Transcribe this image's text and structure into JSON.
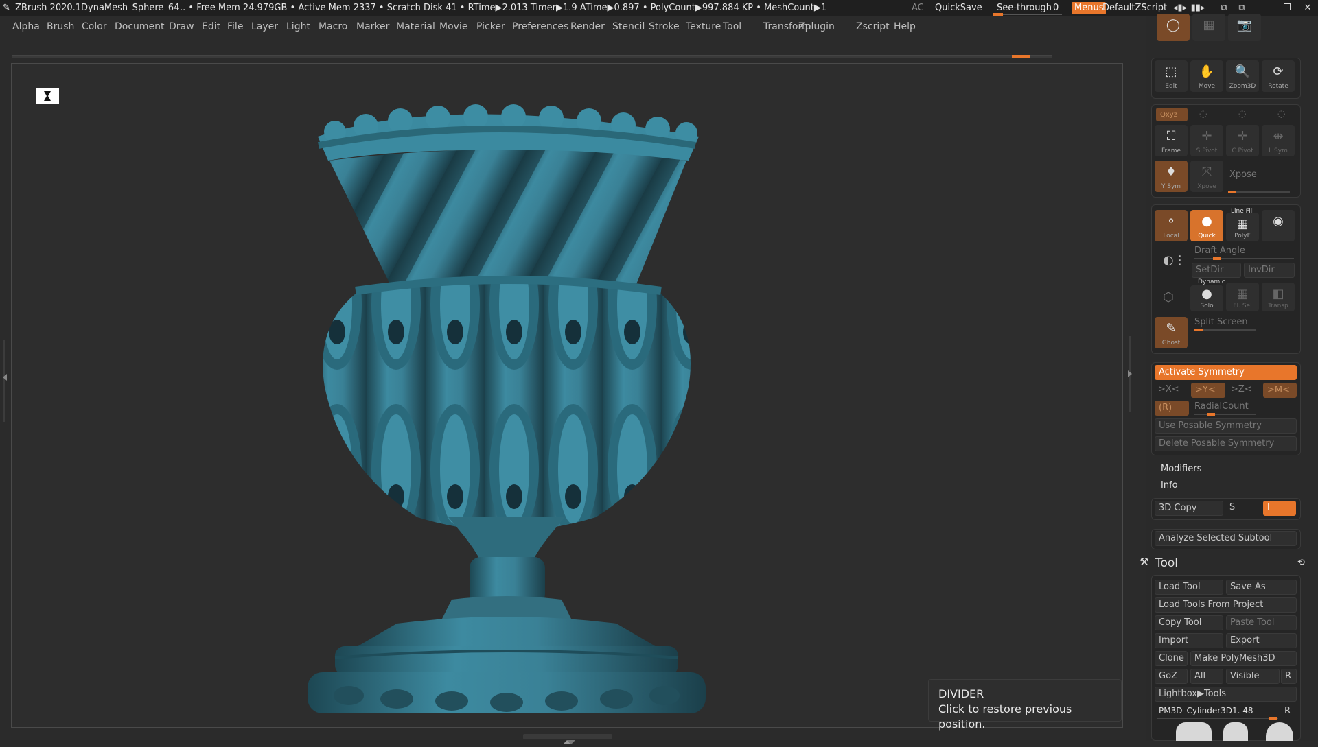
{
  "titlebar": {
    "app": "ZBrush 2020.1",
    "document": "DynaMesh_Sphere_64",
    "stats": ".. • Free Mem 24.979GB • Active Mem 2337 • Scratch Disk 41 •  RTime▶2.013 Timer▶1.9 ATime▶0.897 • PolyCount▶997.884 KP  • MeshCount▶1",
    "ac": "AC",
    "quicksave": "QuickSave",
    "see_through_label": "See-through",
    "see_through_value": "0",
    "see_through_level": 0,
    "menus": "Menus",
    "script": "DefaultZScript"
  },
  "menubar": [
    "Alpha",
    "Brush",
    "Color",
    "Document",
    "Draw",
    "Edit",
    "File",
    "Layer",
    "Light",
    "Macro",
    "Marker",
    "Material",
    "Movie",
    "Picker",
    "Preferences",
    "Render",
    "Stencil",
    "Stroke",
    "Texture",
    "Tool",
    "Transform",
    "Zplugin",
    "Zscript",
    "Help"
  ],
  "tooltip": {
    "title": "DIVIDER",
    "text": "Click to restore previous position."
  },
  "right_panel": {
    "nav_buttons": [
      "Edit",
      "Move",
      "Zoom3D",
      "Rotate"
    ],
    "frame_row": [
      "Frame",
      "S.Pivot",
      "C.Pivot",
      "L.Sym"
    ],
    "xyz_label": "Qxyz",
    "vsym_label": "Y Sym",
    "xpose_btn": "Xpose",
    "xpose_label": "Xpose",
    "local_label": "Local",
    "quick_label": "Quick",
    "linefill_label": "Line Fill",
    "polyf_label": "PolyF",
    "draft_angle": "Draft Angle",
    "setdir": "SetDir",
    "invdir": "InvDir",
    "dynamic_label": "Dynamic",
    "solo_label": "Solo",
    "ftsel_label": "Fl. Sel",
    "transp_label": "Transp",
    "ghost_label": "Ghost",
    "split_screen": "Split Screen",
    "activate_symmetry": "Activate Symmetry",
    "sym_axes": [
      ">X<",
      ">Y<",
      ">Z<",
      ">M<"
    ],
    "radial_r": "(R)",
    "radial_count": "RadialCount",
    "use_posable": "Use Posable Symmetry",
    "delete_posable": "Delete Posable Symmetry",
    "modifiers": "Modifiers",
    "info": "Info",
    "copy3d": "3D Copy",
    "copy_s": "S",
    "copy_i": "I",
    "analyze": "Analyze Selected Subtool"
  },
  "tool_palette": {
    "title": "Tool",
    "load_tool": "Load Tool",
    "save_as": "Save As",
    "load_from_project": "Load Tools From Project",
    "copy_tool": "Copy Tool",
    "paste_tool": "Paste Tool",
    "import": "Import",
    "export": "Export",
    "clone": "Clone",
    "make_polymesh": "Make PolyMesh3D",
    "goz": "GoZ",
    "all": "All",
    "visible": "Visible",
    "r": "R",
    "lightbox_tools": "Lightbox▶Tools",
    "current_tool": "PM3D_Cylinder3D1. 48",
    "current_r": "R"
  },
  "colors": {
    "accent": "#e8762b",
    "vase": "#3d8aa0"
  }
}
